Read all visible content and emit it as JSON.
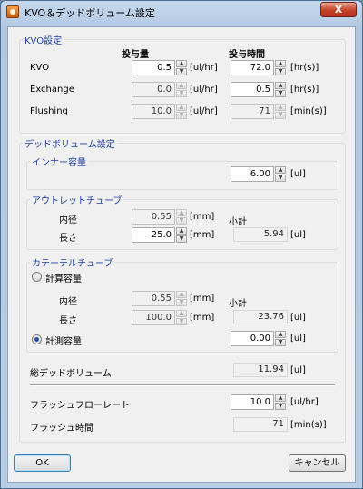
{
  "window": {
    "title": "KVO＆デッドボリューム設定",
    "close_symbol": "X"
  },
  "kvo": {
    "legend": "KVO設定",
    "col_volume": "投与量",
    "col_time": "投与時間",
    "rows": [
      {
        "label": "KVO",
        "volume": "0.5",
        "volume_unit": "[ul/hr]",
        "time": "72.0",
        "time_unit": "[hr(s)]"
      },
      {
        "label": "Exchange",
        "volume": "0.0",
        "volume_unit": "[ul/hr]",
        "time": "0.5",
        "time_unit": "[hr(s)]"
      },
      {
        "label": "Flushing",
        "volume": "10.0",
        "volume_unit": "[ul/hr]",
        "time": "71",
        "time_unit": "[min(s)]"
      }
    ]
  },
  "dead": {
    "legend": "デッドボリューム設定",
    "inner": {
      "legend": "インナー容量",
      "value": "6.00",
      "unit": "[ul]"
    },
    "outlet": {
      "legend": "アウトレットチューブ",
      "diameter_label": "内径",
      "diameter": "0.55",
      "diameter_unit": "[mm]",
      "length_label": "長さ",
      "length": "25.0",
      "length_unit": "[mm]",
      "subtotal_label": "小計",
      "subtotal": "5.94",
      "subtotal_unit": "[ul]"
    },
    "catheter": {
      "legend": "カテーテルチューブ",
      "calc_label": "計算容量",
      "diameter_label": "内径",
      "diameter": "0.55",
      "diameter_unit": "[mm]",
      "length_label": "長さ",
      "length": "100.0",
      "length_unit": "[mm]",
      "subtotal_label": "小計",
      "subtotal": "23.76",
      "subtotal_unit": "[ul]",
      "measured_label": "計測容量",
      "measured": "0.00",
      "measured_unit": "[ul]",
      "selected": "measured"
    },
    "total": {
      "label": "総デッドボリューム",
      "value": "11.94",
      "unit": "[ul]"
    },
    "flush_rate": {
      "label": "フラッシュフローレート",
      "value": "10.0",
      "unit": "[ul/hr]"
    },
    "flush_time": {
      "label": "フラッシュ時間",
      "value": "71",
      "unit": "[min(s)]"
    }
  },
  "buttons": {
    "ok": "OK",
    "cancel": "キャンセル"
  }
}
